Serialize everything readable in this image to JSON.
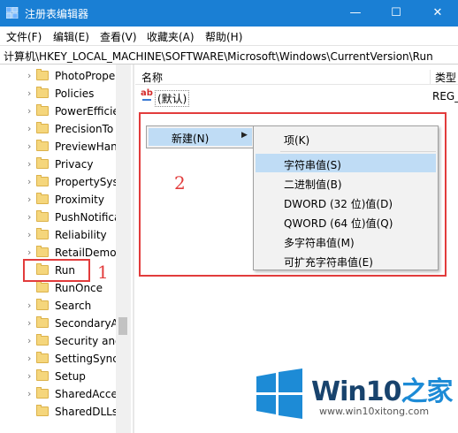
{
  "window": {
    "title": "注册表编辑器",
    "min_glyph": "—",
    "max_glyph": "☐",
    "close_glyph": "✕",
    "title_icon": "registry-icon"
  },
  "menubar": [
    "文件(F)",
    "编辑(E)",
    "查看(V)",
    "收藏夹(A)",
    "帮助(H)"
  ],
  "address": "计算机\\HKEY_LOCAL_MACHINE\\SOFTWARE\\Microsoft\\Windows\\CurrentVersion\\Run",
  "tree": {
    "items": [
      {
        "label": "PhotoPrope",
        "expandable": true
      },
      {
        "label": "Policies",
        "expandable": true
      },
      {
        "label": "PowerEfficie",
        "expandable": true
      },
      {
        "label": "PrecisionTo",
        "expandable": true
      },
      {
        "label": "PreviewHan",
        "expandable": true
      },
      {
        "label": "Privacy",
        "expandable": true
      },
      {
        "label": "PropertySys",
        "expandable": true
      },
      {
        "label": "Proximity",
        "expandable": true
      },
      {
        "label": "PushNotifica",
        "expandable": true
      },
      {
        "label": "Reliability",
        "expandable": true
      },
      {
        "label": "RetailDemo",
        "expandable": true
      },
      {
        "label": "Run",
        "expandable": false
      },
      {
        "label": "RunOnce",
        "expandable": false
      },
      {
        "label": "Search",
        "expandable": true
      },
      {
        "label": "SecondaryA",
        "expandable": true
      },
      {
        "label": "Security and",
        "expandable": true
      },
      {
        "label": "SettingSync",
        "expandable": true
      },
      {
        "label": "Setup",
        "expandable": true
      },
      {
        "label": "SharedAcce",
        "expandable": true
      },
      {
        "label": "SharedDLLs",
        "expandable": false
      }
    ]
  },
  "list": {
    "col_name": "名称",
    "col_type": "类型",
    "rows": [
      {
        "icon": "ab",
        "name": "(默认)",
        "type": "REG_"
      }
    ]
  },
  "context_menu": {
    "new_item": "新建(N)",
    "submenu": [
      "项(K)",
      "字符串值(S)",
      "二进制值(B)",
      "DWORD (32 位)值(D)",
      "QWORD (64 位)值(Q)",
      "多字符串值(M)",
      "可扩充字符串值(E)"
    ],
    "highlighted_index": 1
  },
  "annotations": {
    "step1": "1",
    "step2": "2",
    "color": "#e23c3c"
  },
  "watermark": {
    "brand_main": "Win10",
    "brand_accent": "之家",
    "url": "www.win10xitong.com"
  },
  "colors": {
    "titlebar": "#1a7fd4",
    "selection": "#bfdcf5",
    "accent": "#1d8bd6",
    "folder": "#f5d67c"
  }
}
